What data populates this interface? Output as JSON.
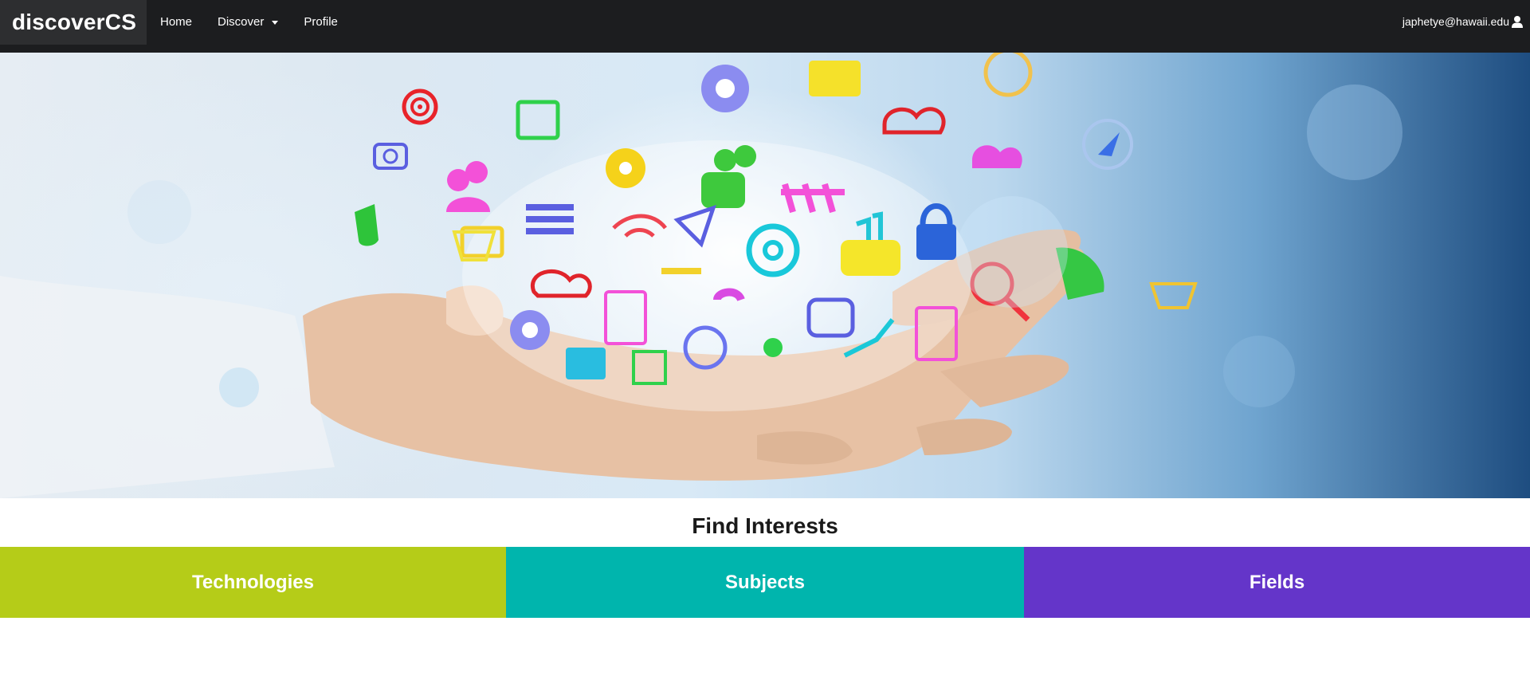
{
  "navbar": {
    "brand": "discoverCS",
    "items": [
      {
        "label": "Home"
      },
      {
        "label": "Discover",
        "has_caret": true
      },
      {
        "label": "Profile"
      }
    ],
    "user_email": "japhetye@hawaii.edu"
  },
  "hero": {
    "description_icon": "hands-holding-app-icons-image"
  },
  "section": {
    "title": "Find Interests",
    "tiles": [
      {
        "label": "Technologies",
        "color": "#b5cc18"
      },
      {
        "label": "Subjects",
        "color": "#00b5ad"
      },
      {
        "label": "Fields",
        "color": "#6435c9"
      }
    ]
  },
  "colors": {
    "navbar_bg": "#1c1d1f",
    "brand_bg": "#2d2e30"
  }
}
